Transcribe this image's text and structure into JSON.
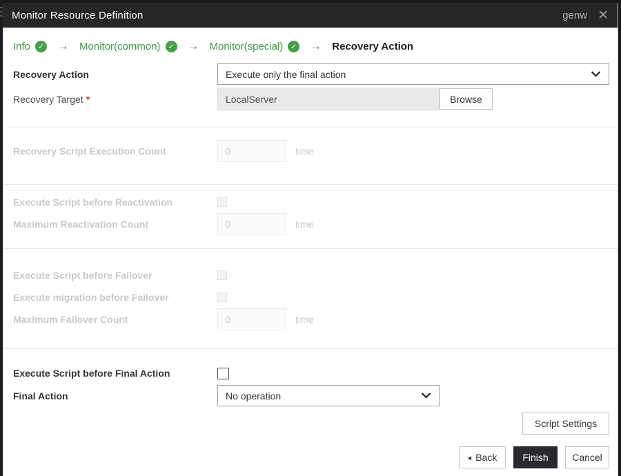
{
  "colors": {
    "header_bg": "#242628",
    "backdrop": "#17191b",
    "accent_green": "#3e9b43",
    "badge_green": "#43a047",
    "finish_button_bg": "#282a30",
    "required_red": "#d0342c",
    "disabled_text": "#c9c9c9"
  },
  "header": {
    "title": "Monitor Resource Definition",
    "resource_name": "genw",
    "close_glyph": "✕"
  },
  "breadcrumb": {
    "arrow_glyph": "→",
    "check_glyph": "✓",
    "items": [
      {
        "label": "Info",
        "completed": true
      },
      {
        "label": "Monitor(common)",
        "completed": true
      },
      {
        "label": "Monitor(special)",
        "completed": true
      },
      {
        "label": "Recovery Action",
        "completed": false,
        "current": true
      }
    ]
  },
  "form": {
    "recovery_action": {
      "label": "Recovery Action",
      "value": "Execute only the final action"
    },
    "recovery_target": {
      "label": "Recovery Target",
      "required_mark": "*",
      "value": "LocalServer",
      "browse_label": "Browse"
    },
    "recovery_script_execution_count": {
      "label": "Recovery Script Execution Count",
      "value": "0",
      "unit": "time",
      "disabled": true
    },
    "execute_script_before_reactivation": {
      "label": "Execute Script before Reactivation",
      "checked": false,
      "disabled": true
    },
    "maximum_reactivation_count": {
      "label": "Maximum Reactivation Count",
      "value": "0",
      "unit": "time",
      "disabled": true
    },
    "execute_script_before_failover": {
      "label": "Execute Script before Failover",
      "checked": false,
      "disabled": true
    },
    "execute_migration_before_failover": {
      "label": "Execute migration before Failover",
      "checked": false,
      "disabled": true
    },
    "maximum_failover_count": {
      "label": "Maximum Failover Count",
      "value": "0",
      "unit": "time",
      "disabled": true
    },
    "execute_script_before_final_action": {
      "label": "Execute Script before Final Action",
      "checked": false,
      "disabled": false
    },
    "final_action": {
      "label": "Final Action",
      "value": "No operation"
    }
  },
  "buttons": {
    "script_settings": "Script Settings",
    "back": "Back",
    "back_arrow_glyph": "◂",
    "finish": "Finish",
    "cancel": "Cancel"
  }
}
